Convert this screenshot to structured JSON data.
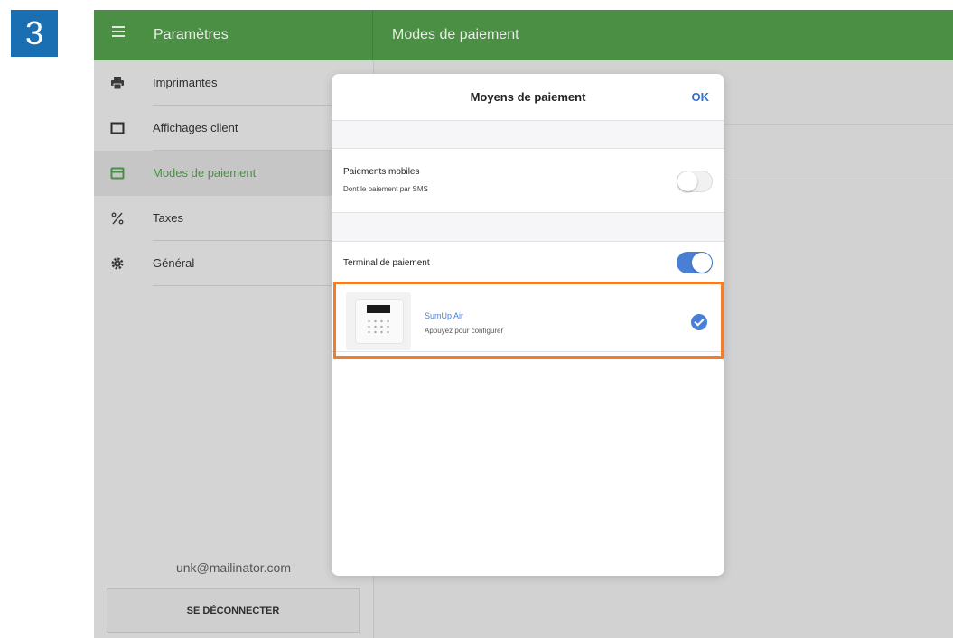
{
  "step": {
    "number": "3"
  },
  "header": {
    "menu_icon": "hamburger-menu-icon",
    "left_title": "Paramètres",
    "right_title": "Modes de paiement",
    "color": "#4a8f44"
  },
  "sidebar": {
    "items": [
      {
        "label": "Imprimantes",
        "icon": "printer-icon",
        "active": false
      },
      {
        "label": "Affichages client",
        "icon": "display-square-icon",
        "active": false
      },
      {
        "label": "Modes de paiement",
        "icon": "credit-card-icon",
        "active": true
      },
      {
        "label": "Taxes",
        "icon": "percent-icon",
        "active": false
      },
      {
        "label": "Général",
        "icon": "gear-icon",
        "active": false
      }
    ],
    "email": "unk@mailinator.com",
    "logout_label": "SE DÉCONNECTER"
  },
  "modal": {
    "title": "Moyens de paiement",
    "ok_label": "OK",
    "mobile_payments": {
      "title": "Paiements mobiles",
      "subtitle": "Dont le paiement par SMS",
      "enabled": false
    },
    "payment_terminal": {
      "title": "Terminal de paiement",
      "enabled": true
    },
    "terminal_device": {
      "name": "SumUp Air",
      "subtitle": "Appuyez pour configurer",
      "selected": true
    }
  },
  "colors": {
    "accent_blue": "#4a7fd6",
    "highlight_orange": "#ef7f2f",
    "step_badge": "#1a6fb3"
  }
}
